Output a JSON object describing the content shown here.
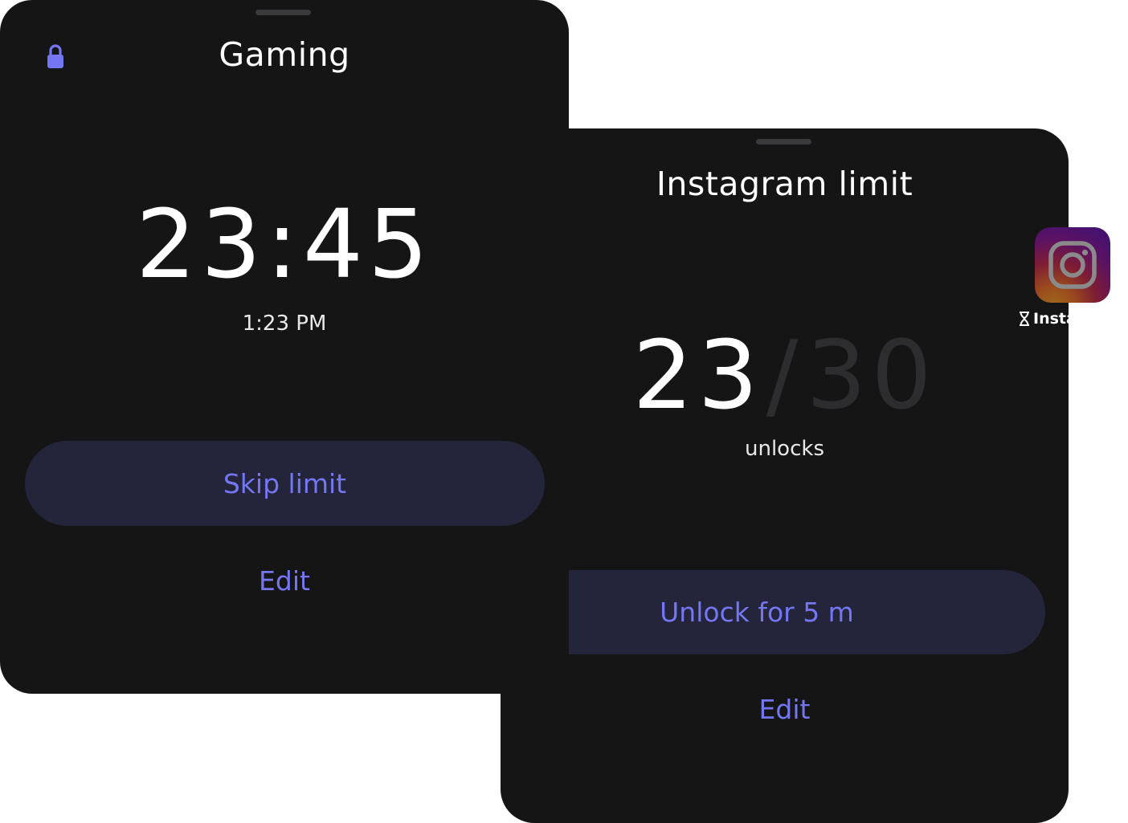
{
  "gaming": {
    "title": "Gaming",
    "timer": "23:45",
    "time": "1:23 PM",
    "skip_label": "Skip limit",
    "edit_label": "Edit"
  },
  "instagram": {
    "title": "Instagram limit",
    "count": "23",
    "separator": "/",
    "max": "30",
    "unit": "unlocks",
    "unlock_label": "Unlock for 5 m",
    "edit_label": "Edit"
  },
  "app_icon": {
    "name": "Instagram",
    "icon": "instagram-icon",
    "badge_icon": "hourglass-icon"
  },
  "colors": {
    "sheet_bg": "#151516",
    "accent": "#7476f2",
    "pill_bg": "#24253b",
    "muted": "#2d2d2f"
  }
}
